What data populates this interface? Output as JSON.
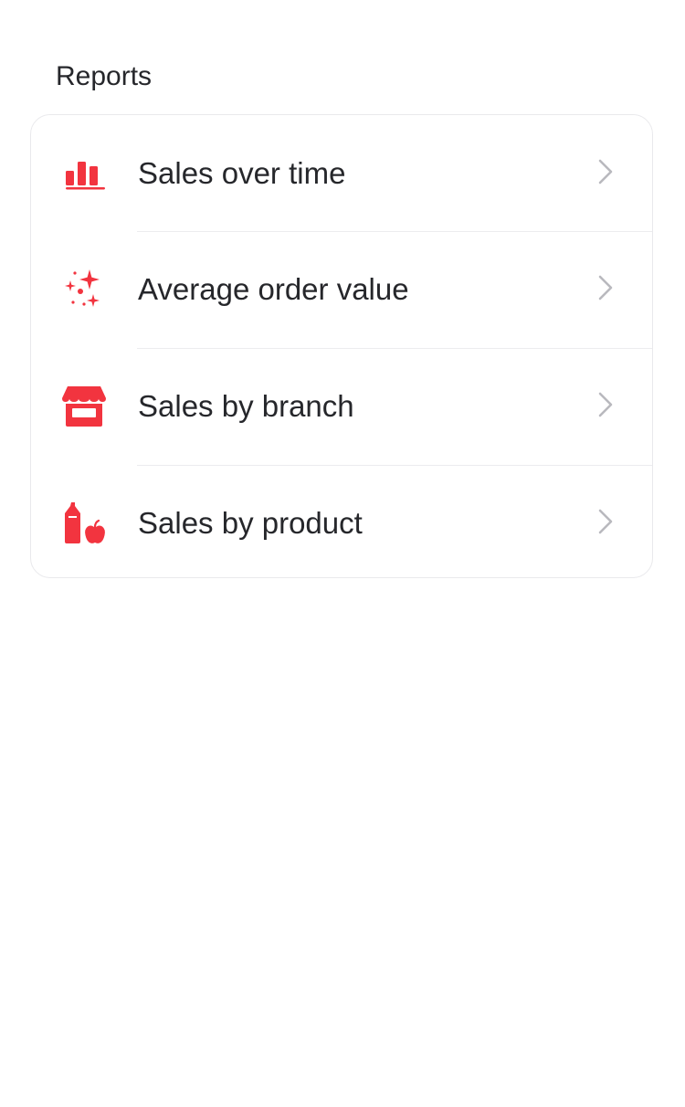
{
  "section": {
    "title": "Reports"
  },
  "accent_color": "#f2343f",
  "reports": {
    "items": [
      {
        "label": "Sales over time",
        "icon": "bar-chart-icon"
      },
      {
        "label": "Average order value",
        "icon": "sparkles-icon"
      },
      {
        "label": "Sales by branch",
        "icon": "storefront-icon"
      },
      {
        "label": "Sales by product",
        "icon": "product-bottle-apple-icon"
      }
    ]
  }
}
